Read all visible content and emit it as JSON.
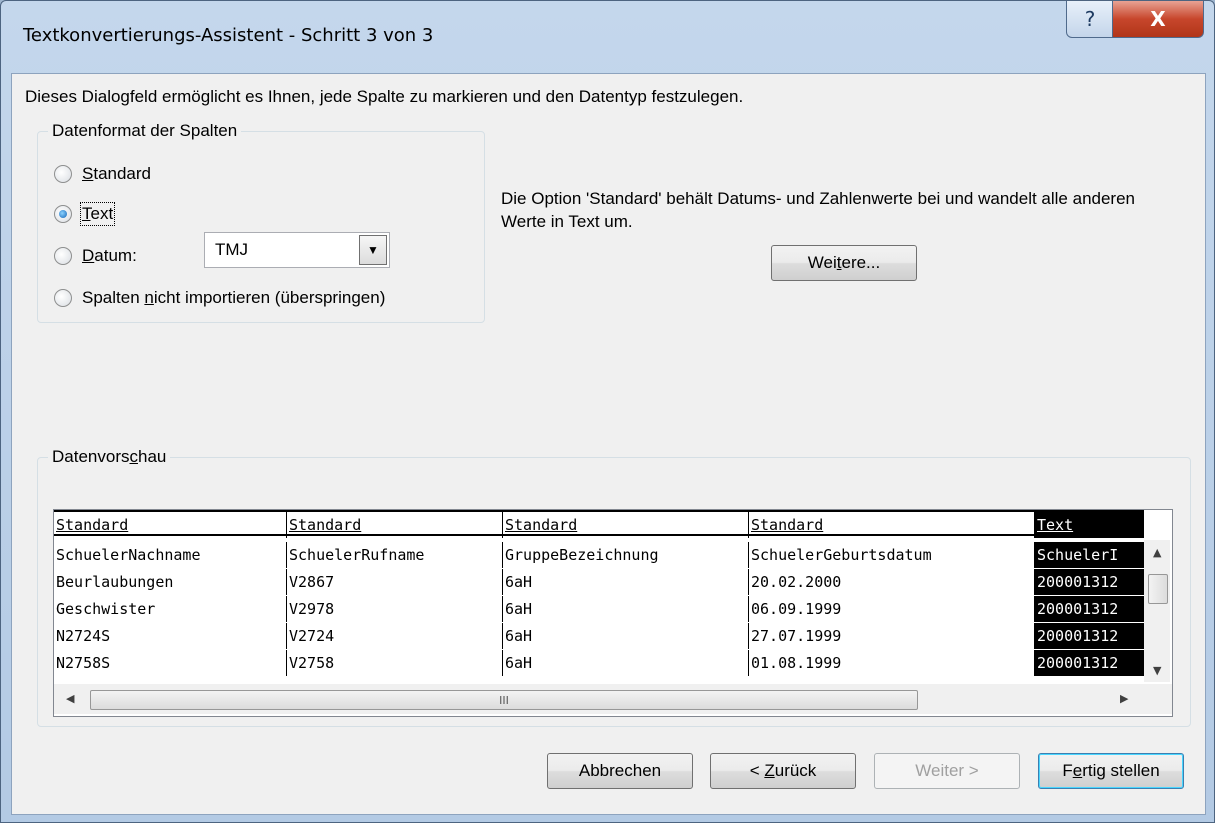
{
  "window": {
    "title": "Textkonvertierungs-Assistent - Schritt 3 von 3",
    "help_glyph": "?",
    "close_glyph": "X"
  },
  "description": "Dieses Dialogfeld ermöglicht es Ihnen, jede Spalte zu markieren und den Datentyp festzulegen.",
  "format_group": {
    "label": "Datenformat der Spalten",
    "options": [
      {
        "pre": "",
        "key": "S",
        "post": "tandard",
        "checked": false
      },
      {
        "pre": "",
        "key": "T",
        "post": "ext",
        "checked": true
      },
      {
        "pre": "",
        "key": "D",
        "post": "atum:",
        "checked": false
      },
      {
        "pre": "Spalten ",
        "key": "n",
        "post": "icht importieren (überspringen)",
        "checked": false
      }
    ],
    "date_format": "TMJ"
  },
  "info_text": "Die Option 'Standard' behält Datums- und Zahlenwerte bei und wandelt alle anderen Werte in Text um.",
  "more_button": {
    "pre": "Wei",
    "key": "t",
    "post": "ere..."
  },
  "preview": {
    "label_pre": "Datenvors",
    "label_key": "c",
    "label_post": "hau",
    "headers": [
      "Standard",
      "Standard",
      "Standard",
      "Standard",
      "Text"
    ],
    "rows": [
      [
        "SchuelerNachname",
        "SchuelerRufname",
        "GruppeBezeichnung",
        "SchuelerGeburtsdatum",
        "SchuelerI"
      ],
      [
        "Beurlaubungen",
        "V2867",
        "6aH",
        "20.02.2000",
        "200001312"
      ],
      [
        "Geschwister",
        "V2978",
        "6aH",
        "06.09.1999",
        "200001312"
      ],
      [
        "N2724S",
        "V2724",
        "6aH",
        "27.07.1999",
        "200001312"
      ],
      [
        "N2758S",
        "V2758",
        "6aH",
        "01.08.1999",
        "200001312"
      ]
    ],
    "hscroll_grip": "III"
  },
  "buttons": {
    "cancel": "Abbrechen",
    "back_pre": "< ",
    "back_key": "Z",
    "back_post": "urück",
    "next": "Weiter >",
    "finish_pre": "F",
    "finish_key": "e",
    "finish_post": "rtig stellen"
  }
}
